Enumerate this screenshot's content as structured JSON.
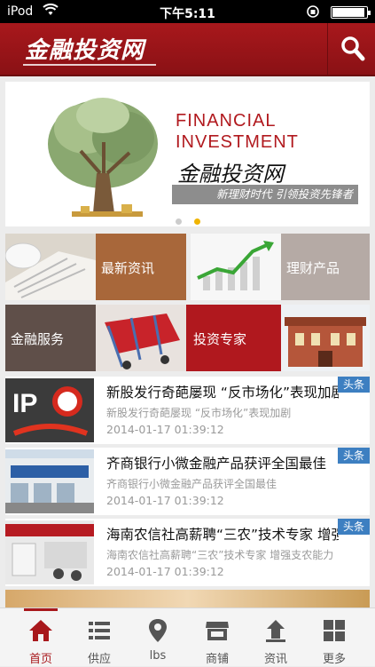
{
  "status_bar": {
    "carrier": "iPod",
    "time": "下午5:11"
  },
  "header": {
    "logo": "金融投资网"
  },
  "banner": {
    "title_line1": "FINANCIAL",
    "title_line2": "INVESTMENT",
    "title_cn": "金融投资网",
    "slogan": "新理财时代 引领投资先锋者",
    "active_slide": 2,
    "slide_count": 2
  },
  "categories": [
    {
      "label": "最新资讯"
    },
    {
      "label": "理财产品"
    },
    {
      "label": "金融服务"
    },
    {
      "label": "投资专家"
    }
  ],
  "news": [
    {
      "title": "新股发行奇葩屡现 “反市场化”表现加剧",
      "summary": "新股发行奇葩屡现 “反市场化”表现加剧",
      "time": "2014-01-17 01:39:12",
      "tag": "头条"
    },
    {
      "title": "齐商银行小微金融产品获评全国最佳",
      "summary": "齐商银行小微金融产品获评全国最佳",
      "time": "2014-01-17 01:39:12",
      "tag": "头条"
    },
    {
      "title": "海南农信社高薪聘“三农”技术专家 增强支农能力",
      "summary": "海南农信社高薪聘“三农”技术专家 增强支农能力",
      "time": "2014-01-17 01:39:12",
      "tag": "头条"
    }
  ],
  "tabbar": [
    {
      "label": "首页",
      "icon": "home-icon",
      "active": true
    },
    {
      "label": "供应",
      "icon": "list-icon"
    },
    {
      "label": "lbs",
      "icon": "location-pin-icon"
    },
    {
      "label": "商铺",
      "icon": "store-icon"
    },
    {
      "label": "资讯",
      "icon": "news-icon"
    },
    {
      "label": "更多",
      "icon": "grid-icon"
    }
  ],
  "colors": {
    "brand": "#a8181c",
    "tag": "#3d7fc1",
    "tile_brown": "#a8673a",
    "tile_gray": "#b5aaa5",
    "tile_dark": "#5f4f49",
    "tile_red": "#b0181e"
  }
}
